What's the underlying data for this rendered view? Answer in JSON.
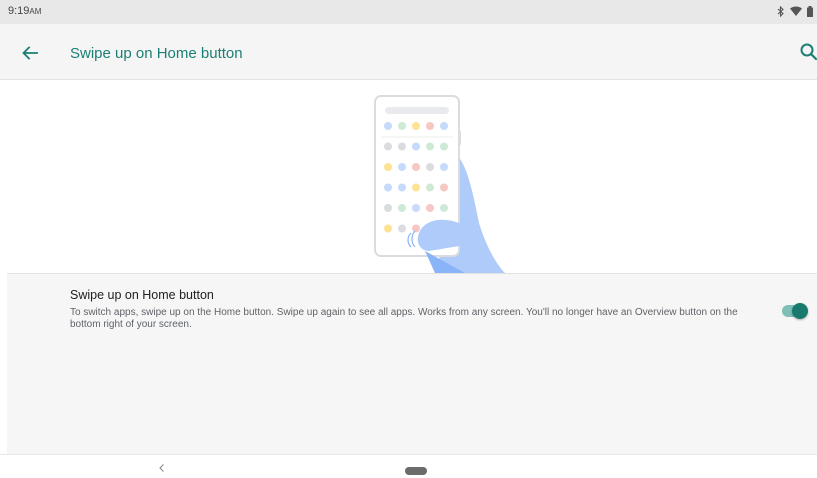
{
  "status_bar": {
    "time": "9:19",
    "ampm": "AM",
    "icons": [
      "bluetooth-icon",
      "wifi-icon",
      "battery-icon"
    ]
  },
  "app_bar": {
    "title": "Swipe up on Home button",
    "back_icon": "arrow-back-icon",
    "search_icon": "search-icon"
  },
  "illustration": {
    "icon": "phone-in-hand-illustration"
  },
  "preference": {
    "title": "Swipe up on Home button",
    "summary": "To switch apps, swipe up on the Home button. Swipe up again to see all apps. Works from any screen. You'll no longer have an Overview button on the bottom right of your screen.",
    "enabled": true
  },
  "nav_bar": {
    "back_icon": "nav-back-icon",
    "home_icon": "nav-home-pill-icon"
  },
  "colors": {
    "accent": "#1a7f74",
    "toggle_thumb": "#187a6e",
    "toggle_track": "#7fbfb8"
  }
}
